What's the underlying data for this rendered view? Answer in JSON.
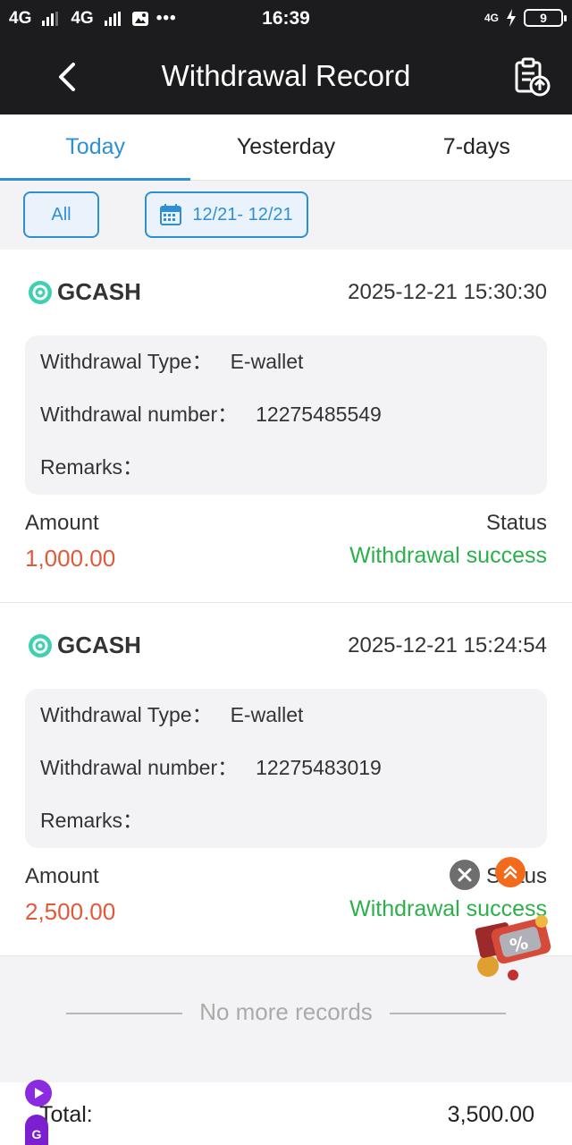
{
  "status_bar": {
    "network_1": "4G",
    "network_2": "4G",
    "time": "16:39",
    "network_right": "4G",
    "battery_level": "9"
  },
  "navbar": {
    "title": "Withdrawal Record"
  },
  "tabs": [
    {
      "label": "Today",
      "active": true
    },
    {
      "label": "Yesterday",
      "active": false
    },
    {
      "label": "7-days",
      "active": false
    }
  ],
  "filters": {
    "all_label": "All",
    "date_range": "12/21- 12/21"
  },
  "records": [
    {
      "method": "GCASH",
      "datetime": "2025-12-21 15:30:30",
      "type_label": "Withdrawal Type：",
      "type_value": "E-wallet",
      "number_label": "Withdrawal number：",
      "number_value": "12275485549",
      "remarks_label": "Remarks：",
      "remarks_value": "",
      "amount_label": "Amount",
      "amount_value": "1,000.00",
      "status_label": "Status",
      "status_value": "Withdrawal success"
    },
    {
      "method": "GCASH",
      "datetime": "2025-12-21 15:24:54",
      "type_label": "Withdrawal Type：",
      "type_value": "E-wallet",
      "number_label": "Withdrawal number：",
      "number_value": "12275483019",
      "remarks_label": "Remarks：",
      "remarks_value": "",
      "amount_label": "Amount",
      "amount_value": "2,500.00",
      "status_label": "Status",
      "status_value": "Withdrawal success"
    }
  ],
  "no_more_text": "No more records",
  "total": {
    "label": "Total:",
    "value": "3,500.00"
  },
  "colors": {
    "accent": "#2f8fd4",
    "amount": "#e05a3a",
    "success": "#2bb04a",
    "header_bg": "#1c1c1e"
  },
  "icons": {
    "back": "chevron-left-icon",
    "nav_action": "clipboard-upload-icon",
    "calendar": "calendar-icon",
    "gcash": "gcash-logo-icon",
    "close": "close-icon",
    "scroll_top": "double-chevron-up-icon",
    "promo": "discount-gift-icon"
  }
}
